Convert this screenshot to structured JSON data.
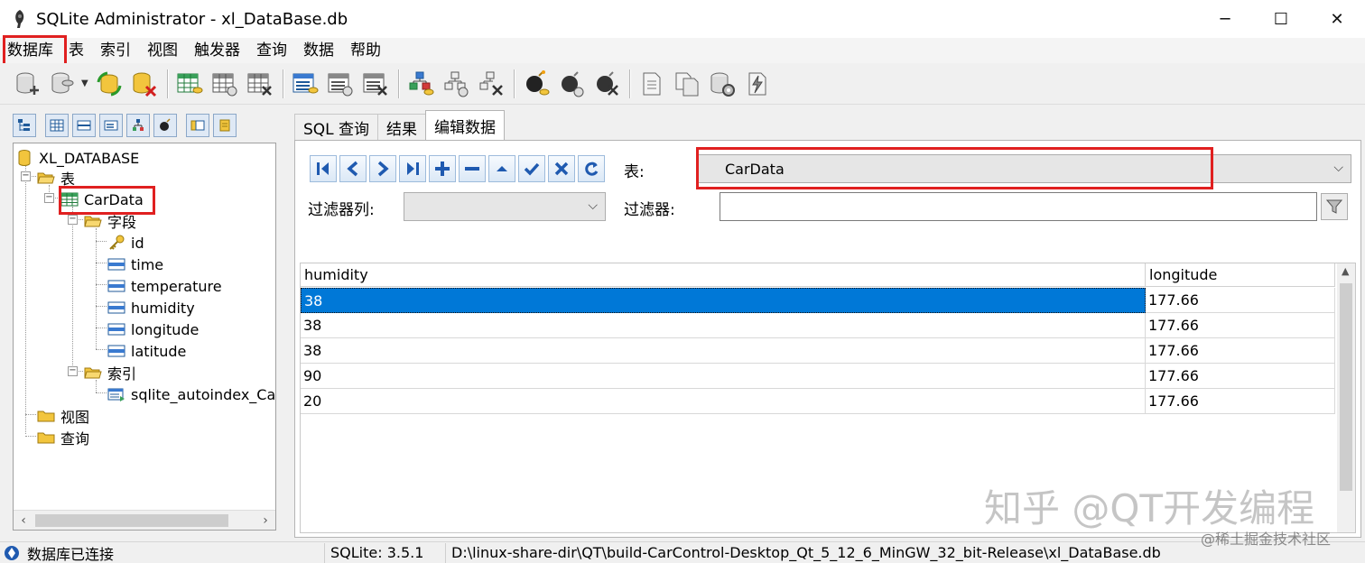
{
  "window": {
    "title": "SQLite Administrator - xl_DataBase.db",
    "minimize": "─",
    "maximize": "☐",
    "close": "✕"
  },
  "menu": [
    "数据库",
    "表",
    "索引",
    "视图",
    "触发器",
    "查询",
    "数据",
    "帮助"
  ],
  "tree": {
    "root": "XL_DATABASE",
    "tables_folder": "表",
    "table": "CarData",
    "fields_folder": "字段",
    "fields": [
      "id",
      "time",
      "temperature",
      "humidity",
      "longitude",
      "latitude"
    ],
    "index_folder": "索引",
    "index_item": "sqlite_autoindex_CarData_1",
    "views_folder": "视图",
    "queries_folder": "查询"
  },
  "tabs": [
    "SQL 查询",
    "结果",
    "编辑数据"
  ],
  "active_tab": "编辑数据",
  "edit": {
    "table_label": "表:",
    "table_value": "CarData",
    "filter_column_label": "过滤器列:",
    "filter_column_value": "",
    "filter_label": "过滤器:",
    "filter_value": ""
  },
  "grid": {
    "columns": [
      "humidity",
      "longitude"
    ],
    "rows": [
      [
        "38",
        "177.66"
      ],
      [
        "38",
        "177.66"
      ],
      [
        "38",
        "177.66"
      ],
      [
        "90",
        "177.66"
      ],
      [
        "20",
        "177.66"
      ]
    ],
    "selected_row": 0
  },
  "status": {
    "connection": "数据库已连接",
    "version": "SQLite: 3.5.1",
    "path": "D:\\linux-share-dir\\QT\\build-CarControl-Desktop_Qt_5_12_6_MinGW_32_bit-Release\\xl_DataBase.db"
  },
  "watermark": {
    "main": "知乎 @QT开发编程",
    "corner": "@稀土掘金技术社区"
  },
  "colors": {
    "highlight_box": "#e02020",
    "selection": "#0078d7"
  }
}
